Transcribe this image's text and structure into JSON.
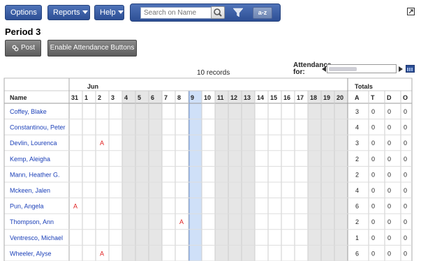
{
  "menus": {
    "options_label": "Options",
    "reports_label": "Reports",
    "help_label": "Help"
  },
  "search": {
    "placeholder": "Search on Name",
    "az_label": "a-z"
  },
  "page": {
    "title": "Period 3"
  },
  "buttons": {
    "post_label": "Post",
    "enable_label": "Enable Attendance Buttons"
  },
  "records_label": "10 records",
  "attendance": {
    "label_line1": "Attendance",
    "label_line2": "for:"
  },
  "table": {
    "month_label": "Jun",
    "name_header": "Name",
    "totals_header": "Totals",
    "days": [
      "31",
      "1",
      "2",
      "3",
      "4",
      "5",
      "6",
      "7",
      "8",
      "9",
      "10",
      "11",
      "12",
      "13",
      "14",
      "15",
      "16",
      "17",
      "18",
      "19",
      "20"
    ],
    "shaded_days": [
      "4",
      "5",
      "6",
      "11",
      "12",
      "13",
      "18",
      "19",
      "20"
    ],
    "selected_day": "9",
    "total_columns": [
      "A",
      "T",
      "D",
      "O"
    ],
    "rows": [
      {
        "name": "Coffey, Blake",
        "marks": {},
        "totals": [
          "3",
          "0",
          "0",
          "0"
        ]
      },
      {
        "name": "Constantinou, Peter",
        "marks": {},
        "totals": [
          "4",
          "0",
          "0",
          "0"
        ]
      },
      {
        "name": "Devlin, Lourenca",
        "marks": {
          "2": "A"
        },
        "totals": [
          "3",
          "0",
          "0",
          "0"
        ]
      },
      {
        "name": "Kemp, Aleigha",
        "marks": {},
        "totals": [
          "2",
          "0",
          "0",
          "0"
        ]
      },
      {
        "name": "Mann, Heather G.",
        "marks": {},
        "totals": [
          "2",
          "0",
          "0",
          "0"
        ]
      },
      {
        "name": "Mckeen, Jalen",
        "marks": {},
        "totals": [
          "4",
          "0",
          "0",
          "0"
        ]
      },
      {
        "name": "Pun, Angela",
        "marks": {
          "31": "A"
        },
        "totals": [
          "6",
          "0",
          "0",
          "0"
        ]
      },
      {
        "name": "Thompson, Ann",
        "marks": {
          "8": "A"
        },
        "totals": [
          "2",
          "0",
          "0",
          "0"
        ]
      },
      {
        "name": "Ventresco, Michael",
        "marks": {},
        "totals": [
          "1",
          "0",
          "0",
          "0"
        ]
      },
      {
        "name": "Wheeler, Alyse",
        "marks": {
          "2": "A"
        },
        "totals": [
          "6",
          "0",
          "0",
          "0"
        ]
      }
    ]
  },
  "colors": {
    "link": "#1a3fb8",
    "absent": "#e02020",
    "selected_col": "#cfe0f8",
    "shaded_col": "#e6e6e6",
    "menu_blue": "#2d4f95"
  },
  "icons": {
    "search": "magnifier-icon",
    "filter": "funnel-icon",
    "popout": "popout-icon",
    "post": "link-icon",
    "calendar": "calendar-icon"
  }
}
